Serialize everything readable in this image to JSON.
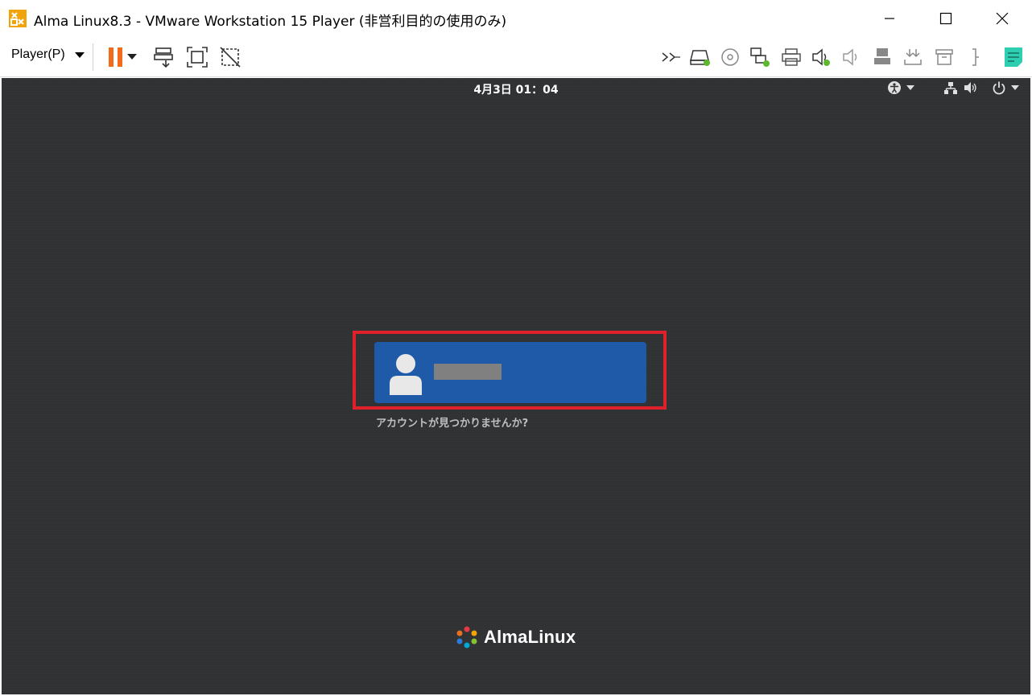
{
  "window": {
    "title": "Alma Linux8.3 - VMware Workstation 15 Player (非営利目的の使用のみ)",
    "controls": [
      "minimize",
      "maximize",
      "close"
    ]
  },
  "toolbar": {
    "player_menu_label": "Player(P)",
    "left_icons": [
      "pause-icon",
      "send-ctrl-alt-del-icon",
      "fullscreen-icon",
      "unity-icon"
    ],
    "right_icons": [
      "more-devices-icon",
      "hard-disk-icon",
      "cd-dvd-icon",
      "network-adapter-icon",
      "printer-icon",
      "sound-card-icon",
      "speaker-icon",
      "usb-device-icon",
      "usb-download-icon",
      "archive-icon",
      "bracket-icon",
      "message-log-icon"
    ],
    "accent_orange": "#f26b1d",
    "status_green": "#5cb82c"
  },
  "vm": {
    "clock": "4月3日 01：04",
    "topbar_icons": [
      "accessibility-icon",
      "network-icon",
      "volume-icon",
      "power-icon"
    ],
    "login": {
      "not_listed_label": "アカウントが見つかりませんか?",
      "card_color": "#1f5aa8",
      "highlight_color": "#e0202a"
    },
    "logo_text": "AlmaLinux",
    "background_color": "#2f3133"
  }
}
